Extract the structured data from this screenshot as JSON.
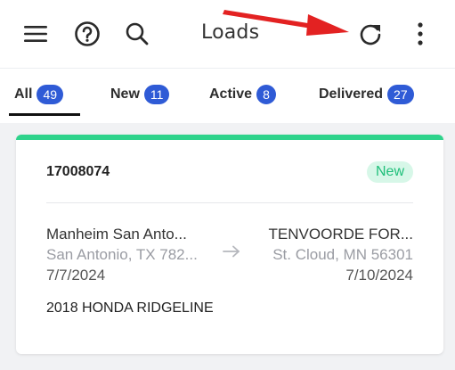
{
  "header": {
    "title": "Loads"
  },
  "icons": {
    "menu": "hamburger-menu-icon",
    "help": "help-circle-icon",
    "search": "search-icon",
    "refresh": "refresh-icon",
    "more": "more-vertical-icon",
    "annotation": "red-arrow-annotation"
  },
  "tabs": [
    {
      "label": "All",
      "count": "49"
    },
    {
      "label": "New",
      "count": "11"
    },
    {
      "label": "Active",
      "count": "8"
    },
    {
      "label": "Delivered",
      "count": "27"
    }
  ],
  "load": {
    "id": "17008074",
    "status": "New",
    "origin": {
      "name": "Manheim San Anto...",
      "city": "San Antonio, TX 782...",
      "date": "7/7/2024"
    },
    "destination": {
      "name": "TENVOORDE FOR...",
      "city": "St. Cloud, MN 56301",
      "date": "7/10/2024"
    },
    "vehicle": "2018 HONDA RIDGELINE"
  },
  "colors": {
    "accent": "#2f5bd6",
    "status_green": "#2ed38b",
    "annotation_red": "#e32222"
  }
}
